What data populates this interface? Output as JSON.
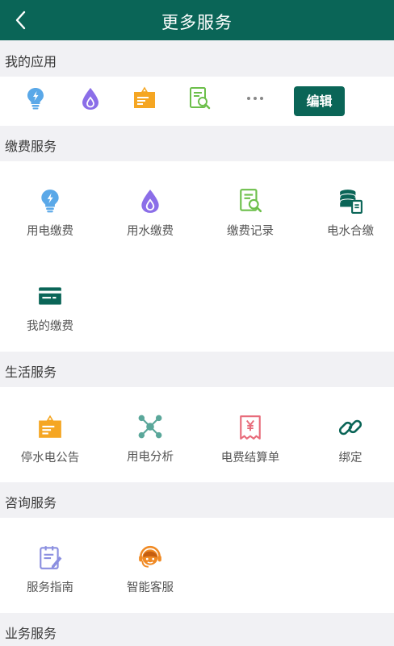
{
  "header": {
    "title": "更多服务"
  },
  "sections": {
    "my_apps": {
      "title": "我的应用",
      "edit_label": "编辑"
    },
    "payment": {
      "title": "缴费服务",
      "items": [
        {
          "label": "用电缴费",
          "icon": "bulb-icon"
        },
        {
          "label": "用水缴费",
          "icon": "water-drop-icon"
        },
        {
          "label": "缴费记录",
          "icon": "record-search-icon"
        },
        {
          "label": "电水合缴",
          "icon": "coins-icon"
        },
        {
          "label": "我的缴费",
          "icon": "card-icon"
        }
      ]
    },
    "life": {
      "title": "生活服务",
      "items": [
        {
          "label": "停水电公告",
          "icon": "notice-board-icon"
        },
        {
          "label": "用电分析",
          "icon": "network-icon"
        },
        {
          "label": "电费结算单",
          "icon": "receipt-icon"
        },
        {
          "label": "绑定",
          "icon": "link-icon"
        }
      ]
    },
    "consult": {
      "title": "咨询服务",
      "items": [
        {
          "label": "服务指南",
          "icon": "guide-icon"
        },
        {
          "label": "智能客服",
          "icon": "customer-service-icon"
        }
      ]
    },
    "business": {
      "title": "业务服务"
    }
  },
  "colors": {
    "primary": "#0a6557",
    "blue": "#5aa8e8",
    "purple": "#8b6ee8",
    "orange": "#f5a623",
    "green": "#6cbf4a",
    "teal": "#5aa79a",
    "pink": "#e86b7a"
  }
}
